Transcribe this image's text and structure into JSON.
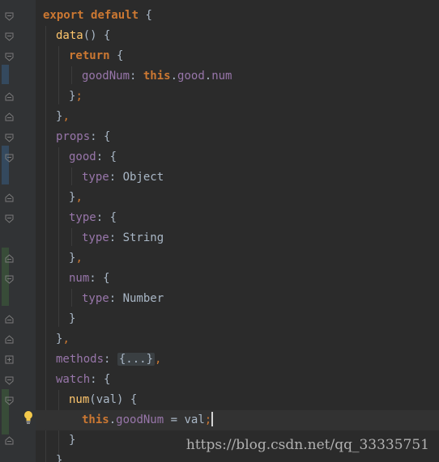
{
  "watermark": "https://blog.csdn.net/qq_33335751",
  "code_lines": [
    "export default {",
    "  data() {",
    "    return {",
    "      goodNum: this.good.num",
    "    };",
    "  },",
    "  props: {",
    "    good: {",
    "      type: Object",
    "    },",
    "    type: {",
    "      type: String",
    "    },",
    "    num: {",
    "      type: Number",
    "    }",
    "  },",
    "  methods: {...},",
    "  watch: {",
    "    num(val) {",
    "      this.goodNum = val;",
    "    }",
    "  }"
  ],
  "tokens": {
    "export": "export",
    "default": "default",
    "return": "return",
    "this": "this",
    "data_fn": "data",
    "num_fn": "num",
    "val_param": "val",
    "goodNum": "goodNum",
    "good": "good",
    "num": "num",
    "props": "props",
    "type": "type",
    "methods": "methods",
    "watch": "watch",
    "Object": "Object",
    "String": "String",
    "Number": "Number",
    "folded": "{...}"
  },
  "colors": {
    "background": "#2b2b2b",
    "gutter": "#313335",
    "keyword": "#cc7832",
    "function": "#ffc66d",
    "property": "#9876aa",
    "text": "#a9b7c6",
    "vcs_modified": "#34495e",
    "vcs_added": "#384c38"
  },
  "icons": {
    "fold_marker": "fold-minus-icon",
    "fold_expand": "fold-plus-icon",
    "intention_bulb": "lightbulb-icon"
  }
}
